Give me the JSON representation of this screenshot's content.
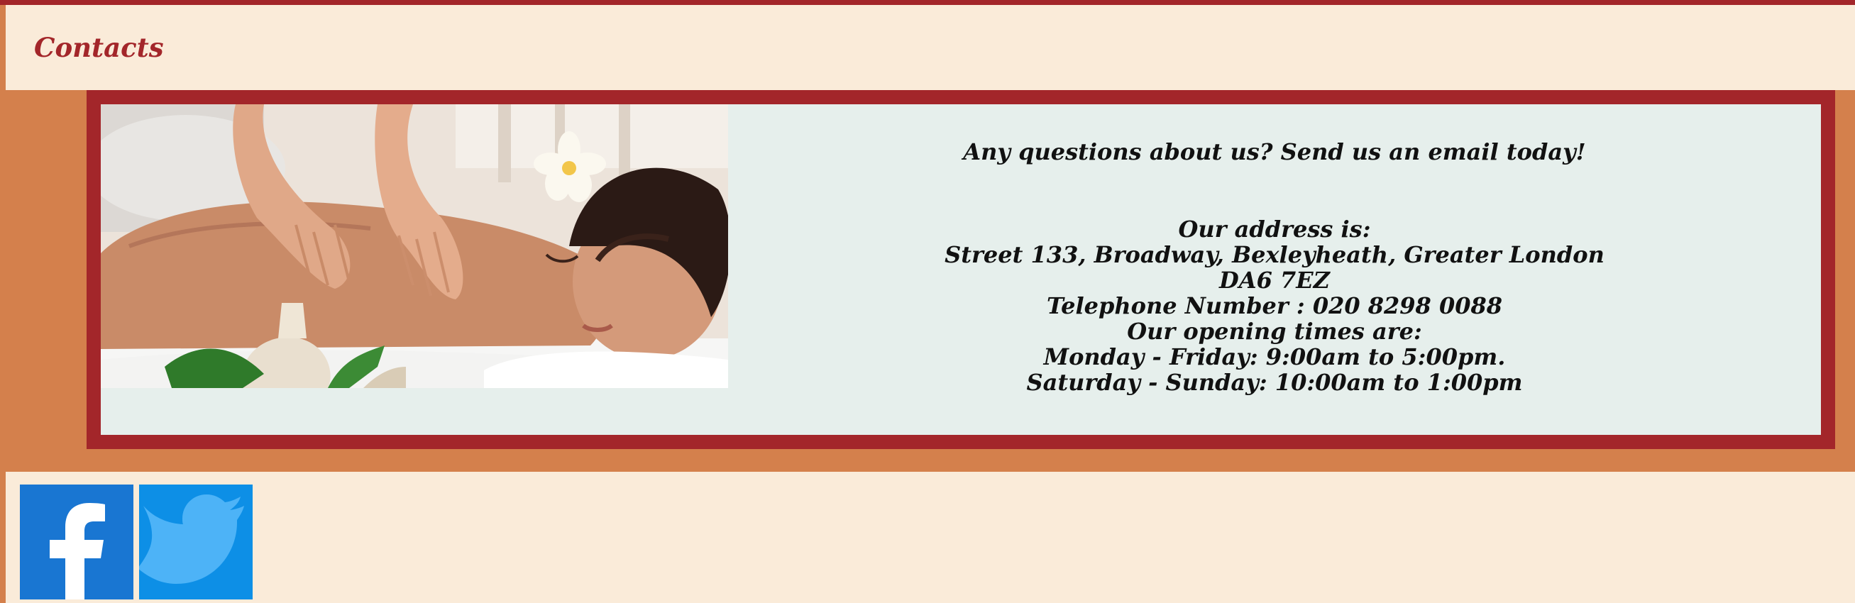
{
  "header": {
    "title": "Contacts"
  },
  "contact": {
    "question": "Any questions about us? Send us an email today!",
    "address_heading": "Our address is:",
    "address_line1": "Street 133, Broadway, Bexleyheath, Greater London",
    "address_line2": "DA6 7EZ",
    "telephone": "Telephone Number : 020 8298 0088",
    "hours_heading": "Our opening times are:",
    "hours_weekday": "Monday - Friday: 9:00am to 5:00pm.",
    "hours_weekend": "Saturday - Sunday: 10:00am to 1:00pm"
  },
  "social": {
    "facebook_icon": "facebook-icon",
    "twitter_icon": "twitter-icon"
  },
  "colors": {
    "accent": "#a3262a",
    "background": "#d4804c",
    "panel": "#faebd9",
    "content": "#e6efec",
    "facebook": "#1976d2",
    "twitter": "#0d8fe6"
  }
}
